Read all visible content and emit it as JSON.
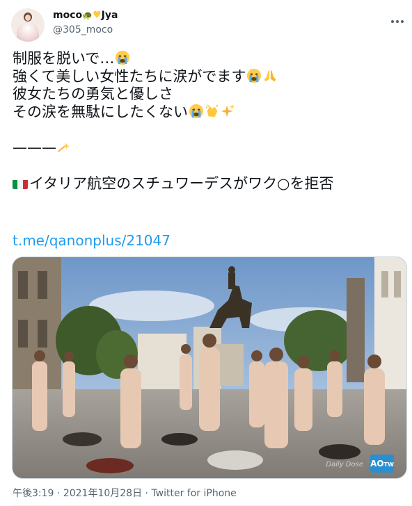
{
  "user": {
    "display_name": "moco",
    "display_name_suffix": "Jya",
    "handle": "@305_moco",
    "name_emojis": [
      "turtle",
      "yellow-heart"
    ]
  },
  "tweet": {
    "lines": [
      "制服を脱いで…",
      "強くて美しい女性たちに涙がでます",
      "彼女たちの勇気と優しさ",
      "その涙を無駄にしたくない",
      "———",
      "イタリア航空のスチュワーデスがワク○を拒否"
    ],
    "link": "t.me/qanonplus/21047"
  },
  "media": {
    "watermark": "AO",
    "watermark_small": "TW",
    "overlay_text": "Daily Dose"
  },
  "meta": {
    "time": "午後3:19",
    "sep1": "·",
    "date": "2021年10月28日",
    "sep2": "·",
    "source": "Twitter for iPhone"
  },
  "colors": {
    "link": "#1d9bf0",
    "secondary_text": "#536471",
    "border": "#cfd9de"
  },
  "icons": [
    "crying-face-icon",
    "folded-hands-icon",
    "clapping-hands-icon",
    "sparkles-icon",
    "dizzy-icon",
    "italy-flag-icon",
    "more-options-icon"
  ]
}
